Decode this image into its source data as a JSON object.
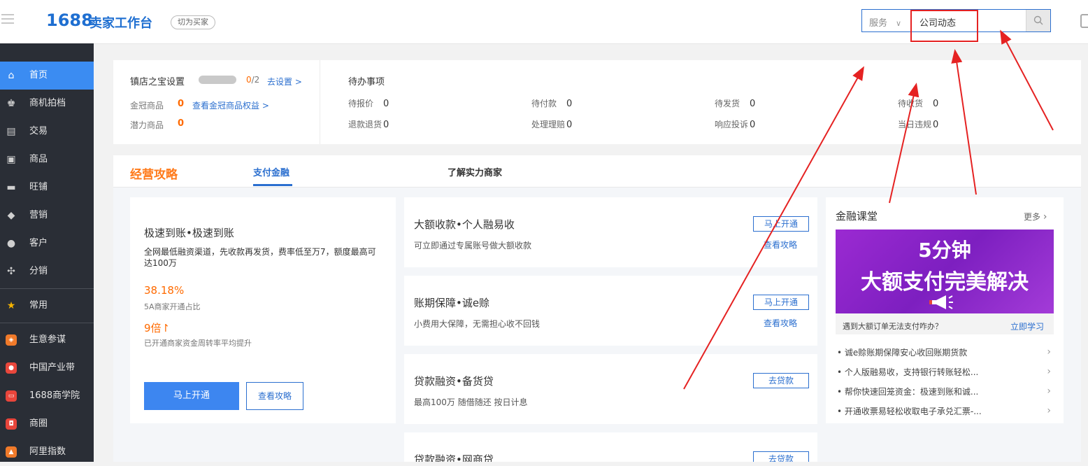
{
  "header": {
    "logo_number": "1688",
    "logo_text": "卖家工作台",
    "switch_label": "切为买家",
    "search_scope": "服务",
    "search_value": "公司动态"
  },
  "sidebar": {
    "items": [
      {
        "label": "首页",
        "icon": "home-icon",
        "active": true
      },
      {
        "label": "商机拍档",
        "icon": "crown-icon"
      },
      {
        "label": "交易",
        "icon": "clipboard-icon"
      },
      {
        "label": "商品",
        "icon": "box-icon"
      },
      {
        "label": "旺铺",
        "icon": "store-icon"
      },
      {
        "label": "营销",
        "icon": "tag-icon"
      },
      {
        "label": "客户",
        "icon": "person-icon"
      },
      {
        "label": "分销",
        "icon": "distribute-icon"
      },
      {
        "label": "常用",
        "icon": "star-icon"
      },
      {
        "label": "生意参谋",
        "icon": "compass-icon"
      },
      {
        "label": "中国产业带",
        "icon": "location-icon"
      },
      {
        "label": "1688商学院",
        "icon": "school-icon"
      },
      {
        "label": "商圈",
        "icon": "circle-icon"
      },
      {
        "label": "阿里指数",
        "icon": "index-icon"
      }
    ]
  },
  "shop_treasure": {
    "title": "镇店之宝设置",
    "count_current": "0",
    "count_total": "/2",
    "setup_link": "去设置 >",
    "crown_label": "金冠商品",
    "crown_value": "0",
    "crown_link": "查看金冠商品权益 >",
    "potential_label": "潜力商品",
    "potential_value": "0"
  },
  "todo": {
    "title": "待办事项",
    "items": [
      {
        "label": "待报价",
        "value": "0"
      },
      {
        "label": "待付款",
        "value": "0"
      },
      {
        "label": "待发货",
        "value": "0"
      },
      {
        "label": "待收货",
        "value": "0"
      },
      {
        "label": "退款退货",
        "value": "0"
      },
      {
        "label": "处理理赔",
        "value": "0"
      },
      {
        "label": "响应投诉",
        "value": "0"
      },
      {
        "label": "当日违规",
        "value": "0"
      }
    ]
  },
  "strategy": {
    "brand": "经营攻略",
    "tabs": [
      "支付金融",
      "了解实力商家"
    ]
  },
  "promo": {
    "title": "极速到账•极速到账",
    "desc": "全网最低融资渠道，先收款再发货，费率低至万7，额度最高可达100万",
    "stat1_value": "38.18%",
    "stat1_label": "5A商家开通占比",
    "stat2_value": "9倍↾",
    "stat2_label": "已开通商家资金周转率平均提升",
    "primary_button": "马上开通",
    "secondary_button": "查看攻略"
  },
  "services": [
    {
      "title": "大额收款•个人融易收",
      "desc": "可立即通过专属账号做大额收款",
      "button": "马上开通",
      "link": "查看攻略"
    },
    {
      "title": "账期保障•诚e赊",
      "desc": "小费用大保障，无需担心收不回钱",
      "button": "马上开通",
      "link": "查看攻略"
    },
    {
      "title": "贷款融资•备货贷",
      "desc": "最高100万 随借随还 按日计息",
      "button": "去贷款",
      "link": ""
    },
    {
      "title": "贷款融资•网商贷",
      "desc": "",
      "button": "去贷款",
      "link": ""
    }
  ],
  "finance_course": {
    "title": "金融课堂",
    "more": "更多",
    "banner_line1": "5分钟",
    "banner_line2": "大额支付完美解决",
    "tip": "遇到大额订单无法支付咋办？",
    "tip_link": "立即学习",
    "items": [
      "诚e赊账期保障安心收回账期货款",
      "个人版融易收，支持银行转账轻松...",
      "帮你快速回笼资金：极速到账和诚...",
      "开通收票易轻松收取电子承兑汇票-..."
    ]
  },
  "colors": {
    "brand_blue": "#1f6fd1",
    "sidebar_bg": "#2a2e36",
    "active_blue": "#3b8cf2",
    "orange": "#ff6a00",
    "annotation_red": "#e52222",
    "banner_purple": "#8e24cc"
  }
}
